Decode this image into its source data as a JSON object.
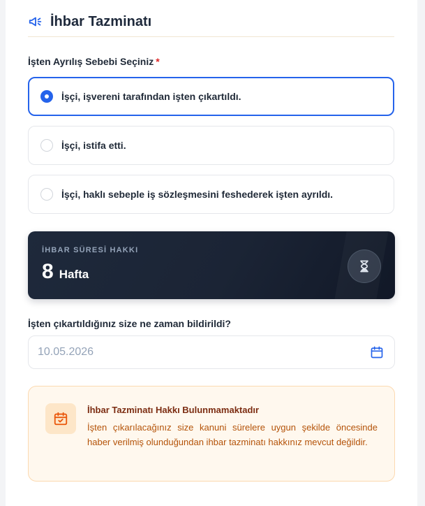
{
  "header": {
    "title": "İhbar Tazminatı",
    "icon": "megaphone-icon"
  },
  "reason": {
    "label": "İşten Ayrılış Sebebi Seçiniz",
    "required_mark": "*",
    "options": [
      {
        "label": "İşçi, işvereni tarafından işten çıkartıldı.",
        "selected": true
      },
      {
        "label": "İşçi, istifa etti.",
        "selected": false
      },
      {
        "label": "İşçi, haklı sebeple iş sözleşmesini feshederek işten ayrıldı.",
        "selected": false
      }
    ]
  },
  "notice_period": {
    "label": "İHBAR SÜRESİ HAKKI",
    "value": "8",
    "unit": "Hafta",
    "icon": "hourglass-icon"
  },
  "notification_date": {
    "label": "İşten çıkartıldığınız size ne zaman bildirildi?",
    "value": "10.05.2026",
    "icon": "calendar-icon"
  },
  "result": {
    "title": "İhbar Tazminatı Hakkı Bulunmamaktadır",
    "body": "İşten çıkarılacağınız size kanuni sürelere uygun şekilde öncesinde haber verilmiş olunduğundan ihbar tazminatı hakkınız mevcut değildir.",
    "icon": "calendar-check-icon"
  },
  "colors": {
    "accent": "#2563eb",
    "dark_card": "#1e293b",
    "alert_bg": "#fff8ee",
    "alert_title": "#7c2d12",
    "alert_text": "#b45309",
    "required": "#dc2626"
  }
}
